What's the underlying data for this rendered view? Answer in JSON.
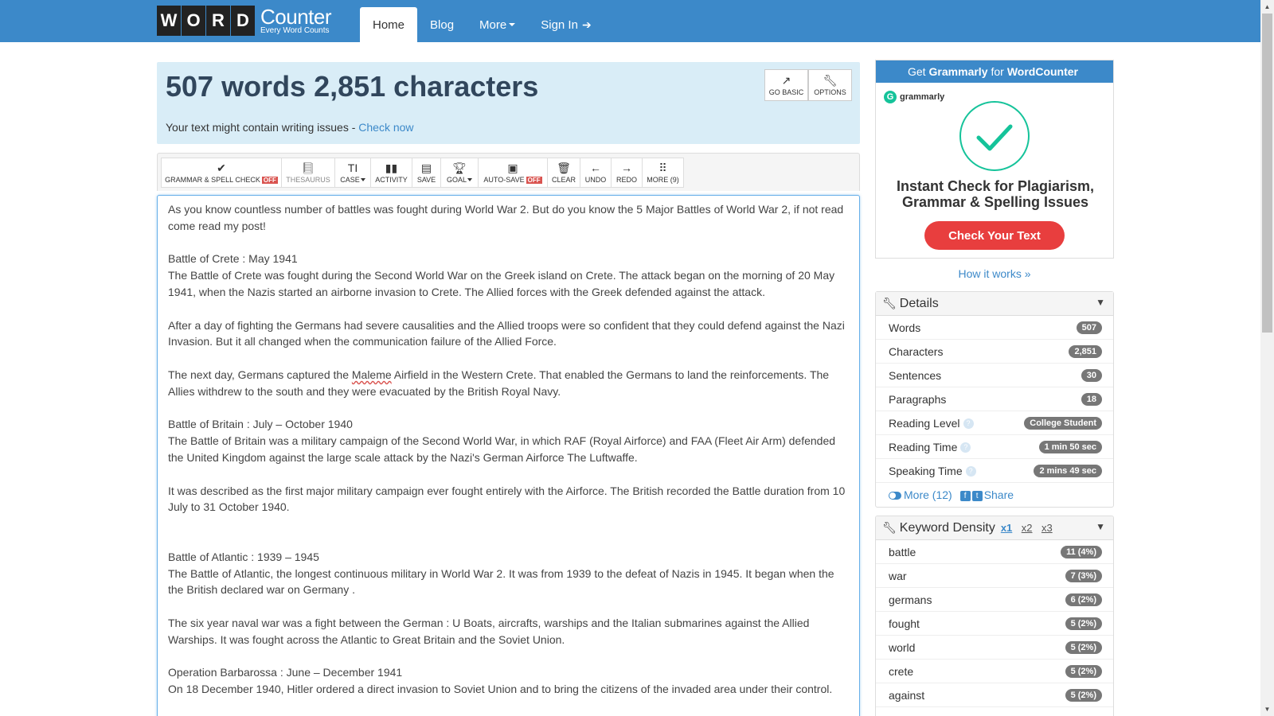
{
  "nav": {
    "logo_letters": [
      "W",
      "O",
      "R",
      "D"
    ],
    "logo_title": "Counter",
    "logo_subtitle": "Every Word Counts",
    "home": "Home",
    "blog": "Blog",
    "more": "More",
    "signin": "Sign In"
  },
  "counts": {
    "title": "507 words 2,851 characters",
    "issues_text": "Your text might contain writing issues - ",
    "issues_link": "Check now",
    "go_basic": "GO BASIC",
    "options": "OPTIONS"
  },
  "toolbar": {
    "grammar": "GRAMMAR & SPELL CHECK",
    "off": "OFF",
    "thesaurus": "THESAURUS",
    "case": "CASE",
    "activity": "ACTIVITY",
    "save": "SAVE",
    "goal": "GOAL",
    "autosave": "AUTO-SAVE",
    "clear": "CLEAR",
    "undo": "UNDO",
    "redo": "REDO",
    "more": "MORE (9)"
  },
  "editor": {
    "p1": "As you know countless number of battles was fought during World War 2. But do you know the 5 Major Battles of World War 2, if not read come read my post!",
    "p2_title": "Battle of Crete : May 1941",
    "p2": "The Battle of Crete was fought during the Second World War on the Greek island on Crete. The attack began on the morning of 20 May 1941, when the Nazis started an airborne invasion to Crete. The Allied forces with the Greek defended against the attack.",
    "p3": "After a day of fighting the Germans had severe causalities and the Allied troops were so confident that they could defend against the Nazi Invasion. But it all changed when the communication failure of the Allied Force.",
    "p4_a": "The next day, Germans captured the ",
    "p4_miss": "Maleme",
    "p4_b": " Airfield in the Western Crete. That enabled the Germans to land the reinforcements. The Allies withdrew to the south and they were evacuated by the British Royal Navy.",
    "p5_title": "Battle of Britain : July – October 1940",
    "p5": "The Battle of Britain was a military campaign of the Second World War, in which RAF (Royal Airforce) and FAA (Fleet Air Arm) defended the United Kingdom against the large scale attack by the Nazi's German Airforce The Luftwaffe.",
    "p6": "It was described as the first major military campaign ever fought entirely with the Airforce. The British recorded the Battle duration from 10 July to 31 October 1940.",
    "p7_title": "Battle of Atlantic : 1939 – 1945",
    "p7": "The Battle of Atlantic, the longest continuous military in World War 2. It was from 1939 to the defeat of Nazis in 1945. It began when the the British declared war on Germany .",
    "p8": "The six year naval war was a fight between the German : U Boats, aircrafts, warships and the Italian submarines against the Allied Warships. It was fought across the Atlantic to Great Britain and the Soviet Union.",
    "p9_title": "Operation Barbarossa : June – December 1941",
    "p9": "On 18 December 1940, Hitler ordered a direct invasion to Soviet Union and to bring the citizens of the invaded area under their control."
  },
  "ad": {
    "header_pre": "Get",
    "header_brand": "Grammarly",
    "header_mid": "for",
    "header_site": "WordCounter",
    "brand": "grammarly",
    "line1": "Instant Check for Plagiarism,",
    "line2": "Grammar & Spelling Issues",
    "button": "Check Your Text",
    "how": "How it works »"
  },
  "details": {
    "title": "Details",
    "rows": [
      {
        "label": "Words",
        "value": "507"
      },
      {
        "label": "Characters",
        "value": "2,851"
      },
      {
        "label": "Sentences",
        "value": "30"
      },
      {
        "label": "Paragraphs",
        "value": "18"
      },
      {
        "label": "Reading Level",
        "value": "College Student"
      },
      {
        "label": "Reading Time",
        "value": "1 min 50 sec"
      },
      {
        "label": "Speaking Time",
        "value": "2 mins 49 sec"
      }
    ],
    "more": "More (12)",
    "share": "Share"
  },
  "density": {
    "title": "Keyword Density",
    "x1": "x1",
    "x2": "x2",
    "x3": "x3",
    "rows": [
      {
        "word": "battle",
        "value": "11 (4%)"
      },
      {
        "word": "war",
        "value": "7 (3%)"
      },
      {
        "word": "germans",
        "value": "6 (2%)"
      },
      {
        "word": "fought",
        "value": "5 (2%)"
      },
      {
        "word": "world",
        "value": "5 (2%)"
      },
      {
        "word": "crete",
        "value": "5 (2%)"
      },
      {
        "word": "against",
        "value": "5 (2%)"
      }
    ]
  },
  "colors": {
    "brand": "#3c89c9",
    "off": "#d9534f",
    "grammarly": "#15c39a",
    "cta": "#e83e3e"
  }
}
